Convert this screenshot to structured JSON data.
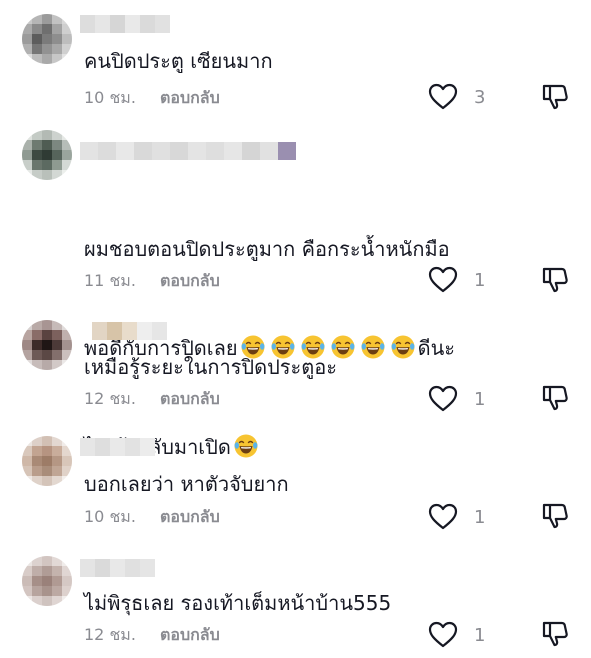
{
  "comments": [
    {
      "text": "คนปิดประตู เซียนมาก",
      "time": "10 ชม.",
      "reply": "ตอบกลับ",
      "likes": "3",
      "avatar_colors": [
        "#c9c9c9",
        "#b5b5b5",
        "#9b9b9b",
        "#c2c2c2",
        "#d8d8d8",
        "#aaaaaa",
        "#8a8a8a",
        "#6f6f6f",
        "#a3a3a3",
        "#cfcfcf",
        "#9c9c9c",
        "#5d5d5d",
        "#7b7b7b",
        "#8e8e8e",
        "#bdbdbd",
        "#b1b1b1",
        "#767676",
        "#929292",
        "#a8a8a8",
        "#d0d0d0",
        "#dcdcdc",
        "#bcbcbc",
        "#a9a9a9",
        "#c7c7c7",
        "#e3e3e3"
      ],
      "name_colors": [
        "#dddddd",
        "#e6e6e6",
        "#d6d6d6",
        "#e9e9e9",
        "#dadada",
        "#e1e1e1"
      ]
    },
    {
      "text_lines": [
        "ผมชอบตอนปิดประตูมาก คือกระน้ำหนักมือ",
        "พอดีกับการปิดเลย",
        "ดีนะ",
        "ไม่เด้งกลับมาเปิด"
      ],
      "emoji": "laughing-crying-emoji",
      "time": "11 ชม.",
      "reply": "ตอบกลับ",
      "likes": "1",
      "avatar_colors": [
        "#dfe3df",
        "#c4cbc5",
        "#b3bab4",
        "#cdd2ce",
        "#e5e8e5",
        "#aab1ab",
        "#6e7a71",
        "#4f5c53",
        "#7c8780",
        "#b6bdb8",
        "#8f9a92",
        "#3d4a42",
        "#2f3b34",
        "#56645b",
        "#9aa59d",
        "#c8cec9",
        "#6a766d",
        "#5c6a61",
        "#8e9a91",
        "#d4d9d5",
        "#e6e9e6",
        "#c6ccc7",
        "#b9c0ba",
        "#d3d8d4",
        "#ecefec"
      ],
      "name_colors": [
        "#e3e3e3",
        "#dcdcdc",
        "#e8e8e8",
        "#d9d9d9",
        "#e0e0e0",
        "#d8d8d8",
        "#e4e4e4",
        "#dedede",
        "#e6e6e6",
        "#d5d5d5",
        "#e1e1e1",
        "#9a8fb0"
      ]
    },
    {
      "text": "เหมือรู้ระยะในการปิดประตูอะ",
      "time": "12 ชม.",
      "reply": "ตอบกลับ",
      "likes": "1",
      "avatar_colors": [
        "#d6d0cf",
        "#b9aaa7",
        "#a89593",
        "#c6bab8",
        "#e0dbda",
        "#b8a4a0",
        "#8a6c68",
        "#5a4340",
        "#7c615d",
        "#c0b0ad",
        "#9e8885",
        "#3d2b29",
        "#1f1615",
        "#4c3a38",
        "#a4928f",
        "#b4a3a0",
        "#6d5956",
        "#5b4845",
        "#836f6c",
        "#cbbfbd",
        "#e1dcdb",
        "#c7bcba",
        "#b7aaa8",
        "#d2c9c7",
        "#ebe8e7"
      ],
      "name_colors": [
        "#e2d5c4",
        "#d7c4a8",
        "#e8dccb",
        "#eeeeee",
        "#e6e6e6"
      ]
    },
    {
      "text": "บอกเลยว่า หาตัวจับยาก",
      "time": "10 ชม.",
      "reply": "ตอบกลับ",
      "likes": "1",
      "avatar_colors": [
        "#ece6e2",
        "#ddd0c8",
        "#d2c0b4",
        "#e3d8d1",
        "#f1ece9",
        "#d9c8bc",
        "#c2a491",
        "#b69481",
        "#c9ad9b",
        "#e4d7ce",
        "#cfb8a8",
        "#a98a76",
        "#9d7c67",
        "#b59784",
        "#d8c6b9",
        "#d6c4b7",
        "#b99d8b",
        "#a98d7a",
        "#c0a695",
        "#e0d2c8",
        "#eee8e4",
        "#dfd2c9",
        "#d4c4b9",
        "#e3d8d0",
        "#f3efec"
      ],
      "name_colors": [
        "#e6e6e6",
        "#dedede",
        "#e9e9e9",
        "#e2e2e2",
        "#ececec"
      ]
    },
    {
      "text": "ไม่พิรุธเลย รองเท้าเต็มหน้าบ้าน555",
      "time": "12 ชม.",
      "reply": "ตอบกลับ",
      "likes": "1",
      "avatar_colors": [
        "#ebe6e4",
        "#dcd2cf",
        "#d2c5c1",
        "#e2d9d6",
        "#f0ecea",
        "#d8ccc8",
        "#bfaea9",
        "#b09c96",
        "#c4b3ad",
        "#e0d6d3",
        "#cbbcb7",
        "#a68f88",
        "#9a817a",
        "#b09a93",
        "#d5c8c4",
        "#d3c5c1",
        "#b7a49e",
        "#a8938c",
        "#bca9a3",
        "#ddd1cd",
        "#ece6e4",
        "#dbd0cd",
        "#cfc3bf",
        "#dfd5d2",
        "#f1edeb"
      ],
      "name_colors": [
        "#e4e4e4",
        "#dadada",
        "#e8e8e8",
        "#e0e0e0",
        "#e5e5e5"
      ]
    }
  ],
  "colors": {
    "text": "#161823",
    "muted": "#8a8b91",
    "icon": "#161823"
  }
}
